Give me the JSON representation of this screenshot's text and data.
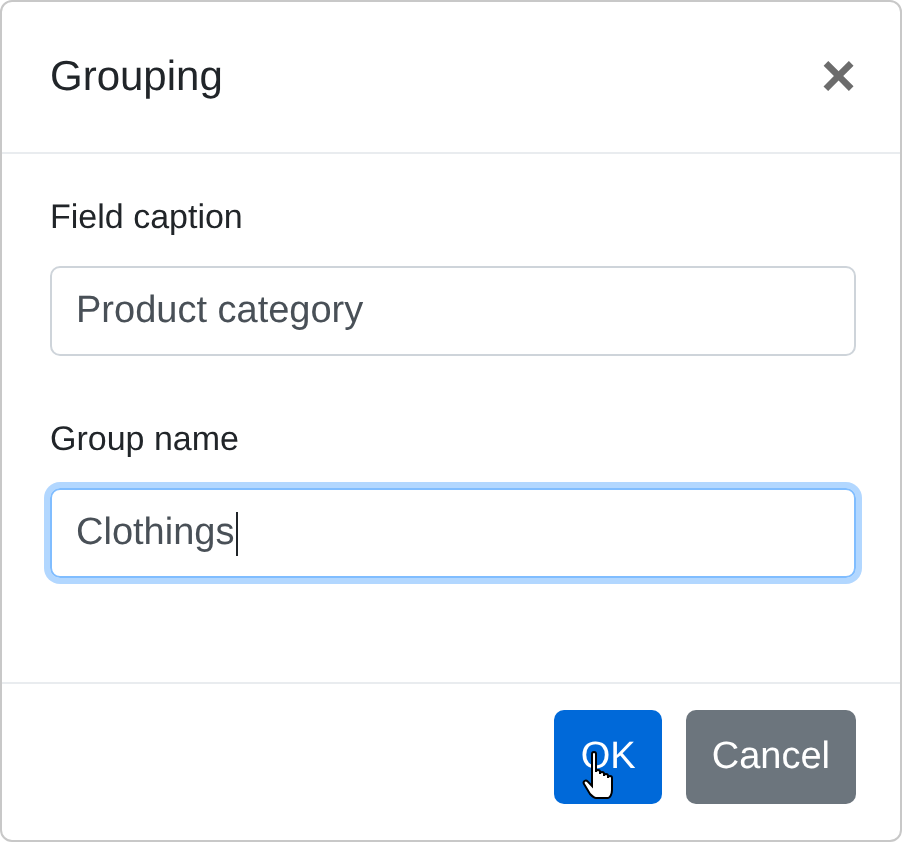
{
  "dialog": {
    "title": "Grouping",
    "close": "×"
  },
  "fields": [
    {
      "label": "Field caption",
      "value": "Product category",
      "focused": false
    },
    {
      "label": "Group name",
      "value": "Clothings",
      "focused": true
    }
  ],
  "buttons": [
    {
      "label": "OK",
      "kind": "primary",
      "hovered": true
    },
    {
      "label": "Cancel",
      "kind": "secondary",
      "hovered": false
    }
  ]
}
